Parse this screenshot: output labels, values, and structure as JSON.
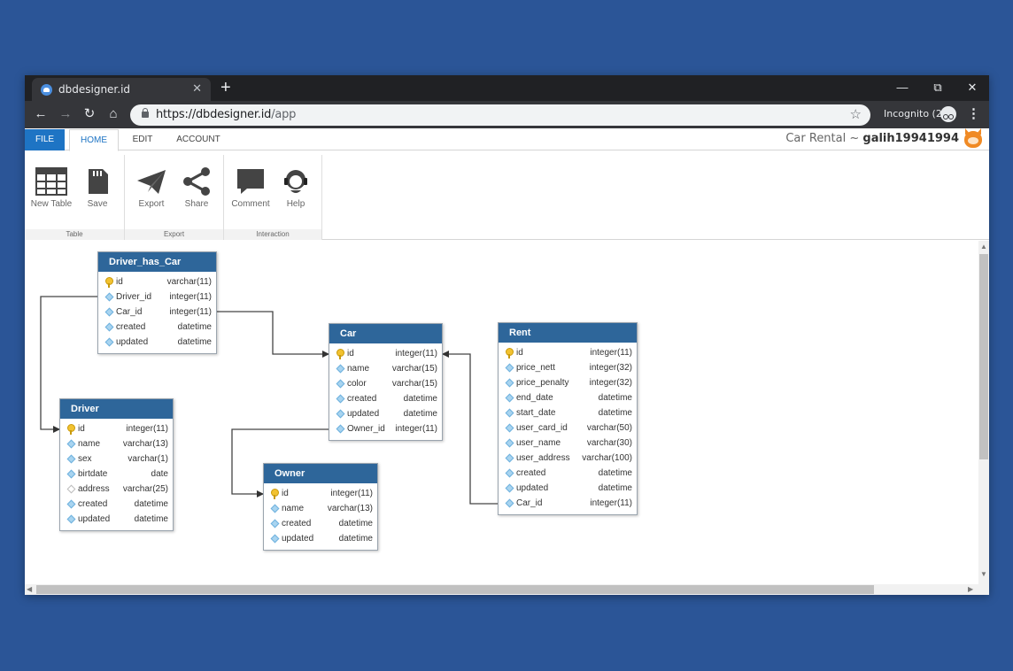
{
  "browser": {
    "tab_title": "dbdesigner.id",
    "tab_close": "✕",
    "new_tab": "+",
    "url_host": "https://dbdesigner.id",
    "url_path": "/app",
    "incognito_label": "Incognito (2)",
    "icons": [
      "back-arrow-icon",
      "forward-arrow-icon",
      "reload-icon",
      "home-icon",
      "lock-icon",
      "star-icon",
      "incognito-icon",
      "kebab-menu-icon"
    ],
    "colors": {
      "frame": "#202124",
      "toolbar": "#35363a",
      "omnibox": "#f1f3f4"
    }
  },
  "menu": {
    "file": "FILE",
    "home": "HOME",
    "edit": "EDIT",
    "account": "ACCOUNT",
    "project_name": "Car Rental ~ ",
    "username": "galih19941994"
  },
  "ribbon": {
    "new_table": "New Table",
    "save": "Save",
    "export": "Export",
    "share": "Share",
    "comment": "Comment",
    "help": "Help",
    "group_table": "Table",
    "group_export": "Export",
    "group_interaction": "Interaction"
  },
  "colors": {
    "background": "#2b5597",
    "accent": "#1e74c4",
    "entity_header": "#2e669a",
    "primary_key": "#f2c230",
    "field_diamond": "#a8d4f0"
  },
  "tables": {
    "driver_has_car": {
      "name": "Driver_has_Car",
      "fields": [
        {
          "name": "id",
          "type": "varchar(11)",
          "icon": "key"
        },
        {
          "name": "Driver_id",
          "type": "integer(11)",
          "icon": "diamond"
        },
        {
          "name": "Car_id",
          "type": "integer(11)",
          "icon": "diamond"
        },
        {
          "name": "created",
          "type": "datetime",
          "icon": "diamond"
        },
        {
          "name": "updated",
          "type": "datetime",
          "icon": "diamond"
        }
      ]
    },
    "car": {
      "name": "Car",
      "fields": [
        {
          "name": "id",
          "type": "integer(11)",
          "icon": "key"
        },
        {
          "name": "name",
          "type": "varchar(15)",
          "icon": "diamond"
        },
        {
          "name": "color",
          "type": "varchar(15)",
          "icon": "diamond"
        },
        {
          "name": "created",
          "type": "datetime",
          "icon": "diamond"
        },
        {
          "name": "updated",
          "type": "datetime",
          "icon": "diamond"
        },
        {
          "name": "Owner_id",
          "type": "integer(11)",
          "icon": "diamond"
        }
      ]
    },
    "rent": {
      "name": "Rent",
      "fields": [
        {
          "name": "id",
          "type": "integer(11)",
          "icon": "key"
        },
        {
          "name": "price_nett",
          "type": "integer(32)",
          "icon": "diamond"
        },
        {
          "name": "price_penalty",
          "type": "integer(32)",
          "icon": "diamond"
        },
        {
          "name": "end_date",
          "type": "datetime",
          "icon": "diamond"
        },
        {
          "name": "start_date",
          "type": "datetime",
          "icon": "diamond"
        },
        {
          "name": "user_card_id",
          "type": "varchar(50)",
          "icon": "diamond"
        },
        {
          "name": "user_name",
          "type": "varchar(30)",
          "icon": "diamond"
        },
        {
          "name": "user_address",
          "type": "varchar(100)",
          "icon": "diamond"
        },
        {
          "name": "created",
          "type": "datetime",
          "icon": "diamond"
        },
        {
          "name": "updated",
          "type": "datetime",
          "icon": "diamond"
        },
        {
          "name": "Car_id",
          "type": "integer(11)",
          "icon": "diamond"
        }
      ]
    },
    "driver": {
      "name": "Driver",
      "fields": [
        {
          "name": "id",
          "type": "integer(11)",
          "icon": "key"
        },
        {
          "name": "name",
          "type": "varchar(13)",
          "icon": "diamond"
        },
        {
          "name": "sex",
          "type": "varchar(1)",
          "icon": "diamond"
        },
        {
          "name": "birtdate",
          "type": "date",
          "icon": "diamond"
        },
        {
          "name": "address",
          "type": "varchar(25)",
          "icon": "diamond-hollow"
        },
        {
          "name": "created",
          "type": "datetime",
          "icon": "diamond"
        },
        {
          "name": "updated",
          "type": "datetime",
          "icon": "diamond"
        }
      ]
    },
    "owner": {
      "name": "Owner",
      "fields": [
        {
          "name": "id",
          "type": "integer(11)",
          "icon": "key"
        },
        {
          "name": "name",
          "type": "varchar(13)",
          "icon": "diamond"
        },
        {
          "name": "created",
          "type": "datetime",
          "icon": "diamond"
        },
        {
          "name": "updated",
          "type": "datetime",
          "icon": "diamond"
        }
      ]
    }
  }
}
